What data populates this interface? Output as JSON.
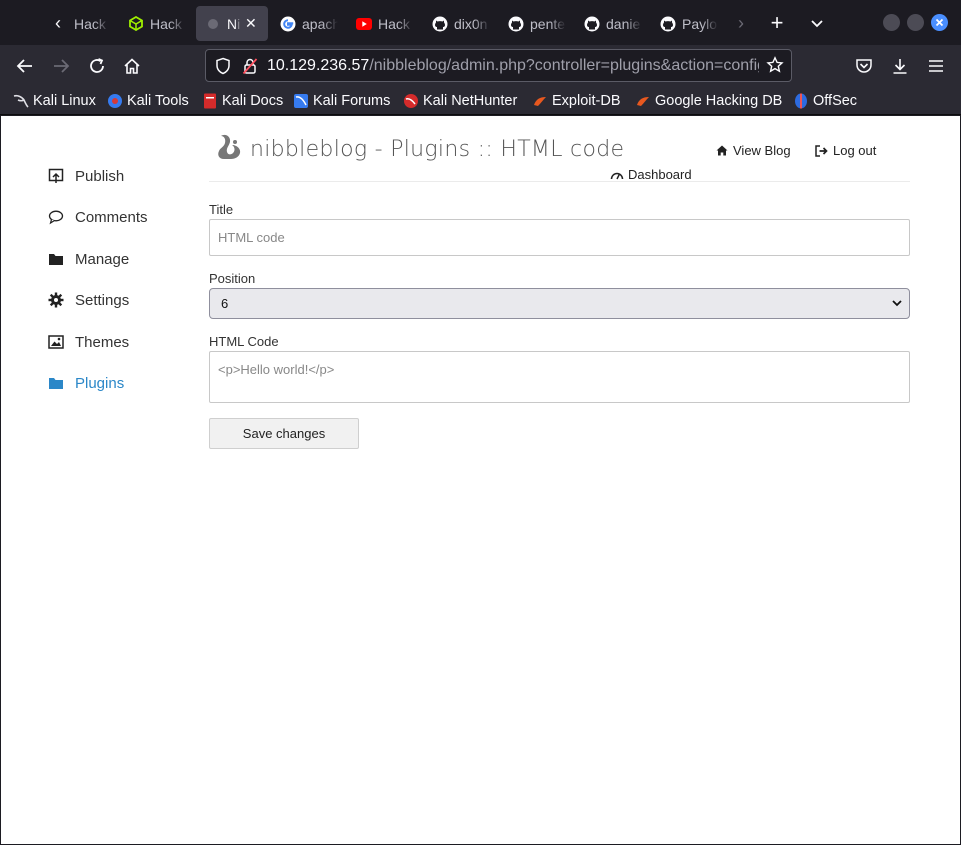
{
  "tabs": [
    {
      "label": "Hack",
      "icon": "hackthebox-icon",
      "active": false
    },
    {
      "label": "Hack",
      "icon": "hackthebox-cube-icon",
      "active": false
    },
    {
      "label": "Nib",
      "icon": "nibbleblog-icon",
      "active": true
    },
    {
      "label": "apach",
      "icon": "google-icon",
      "active": false
    },
    {
      "label": "Hack",
      "icon": "youtube-icon",
      "active": false
    },
    {
      "label": "dix0n",
      "icon": "github-icon",
      "active": false
    },
    {
      "label": "pente",
      "icon": "github-icon",
      "active": false
    },
    {
      "label": "danie",
      "icon": "github-icon",
      "active": false
    },
    {
      "label": "Paylo",
      "icon": "github-icon",
      "active": false
    }
  ],
  "address_bar": {
    "host": "10.129.236.57",
    "path": "/nibbleblog/admin.php?controller=plugins&action=config&"
  },
  "bookmarks": [
    {
      "label": "Kali Linux",
      "icon": "kali-dragon-icon"
    },
    {
      "label": "Kali Tools",
      "icon": "kali-tools-icon"
    },
    {
      "label": "Kali Docs",
      "icon": "kali-docs-icon"
    },
    {
      "label": "Kali Forums",
      "icon": "kali-forums-icon"
    },
    {
      "label": "Kali NetHunter",
      "icon": "nethunter-icon"
    },
    {
      "label": "Exploit-DB",
      "icon": "exploit-db-icon"
    },
    {
      "label": "Google Hacking DB",
      "icon": "ghdb-icon"
    },
    {
      "label": "OffSec",
      "icon": "offsec-icon"
    }
  ],
  "sidebar": {
    "items": [
      {
        "label": "Publish",
        "icon": "publish-icon"
      },
      {
        "label": "Comments",
        "icon": "comment-icon"
      },
      {
        "label": "Manage",
        "icon": "folder-icon"
      },
      {
        "label": "Settings",
        "icon": "gear-icon"
      },
      {
        "label": "Themes",
        "icon": "image-icon"
      },
      {
        "label": "Plugins",
        "icon": "folder-open-icon",
        "active": true
      }
    ]
  },
  "header": {
    "title": "nibbleblog - Plugins :: HTML code",
    "view_blog": "View Blog",
    "log_out": "Log out",
    "dashboard": "Dashboard"
  },
  "form": {
    "title_label": "Title",
    "title_placeholder": "HTML code",
    "position_label": "Position",
    "position_value": "6",
    "html_label": "HTML Code",
    "html_placeholder": "<p>Hello world!</p>",
    "save_label": "Save changes"
  },
  "colors": {
    "accent": "#2b87c8",
    "chrome_dark": "#1c1b22",
    "chrome_toolbar": "#2b2a33"
  }
}
